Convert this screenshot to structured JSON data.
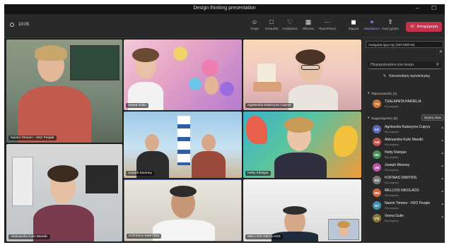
{
  "window": {
    "title": "Design thinking presentation",
    "minimize": "–",
    "close": "☐"
  },
  "meeting": {
    "elapsed": "10:05"
  },
  "toolbar": {
    "buttons": [
      {
        "id": "people",
        "label": "Άτομα",
        "icon": "people-icon"
      },
      {
        "id": "chat",
        "label": "Συνομιλία",
        "icon": "chat-icon"
      },
      {
        "id": "react",
        "label": "Αντιδράσεις",
        "icon": "react-icon"
      },
      {
        "id": "rooms",
        "label": "Αίθουσες",
        "icon": "rooms-icon"
      },
      {
        "id": "more",
        "label": "Περισσότερα",
        "icon": "more-icon"
      },
      {
        "id": "camera",
        "label": "Κάμερα",
        "icon": "camera-icon"
      },
      {
        "id": "mic",
        "label": "Μικρόφωνο",
        "icon": "mic-icon"
      },
      {
        "id": "share",
        "label": "Κοινή χρήση",
        "icon": "share-icon"
      }
    ],
    "leave_label": "Αποχώρηση"
  },
  "tiles": [
    {
      "name": "Naomi Timmer - H2O People"
    },
    {
      "name": "Vesna Gulin"
    },
    {
      "name": "Agnieszka Katarzyna Cuprys"
    },
    {
      "name": "Joseph Mooney"
    },
    {
      "name": "Hetty Kleinjan"
    },
    {
      "name": "Aleksandra Kulic Mandic"
    },
    {
      "name": "KOFINAS DIMITRIS"
    },
    {
      "name": "MELLIOS NIKOLAOS"
    }
  ],
  "panel": {
    "tooltip": "Ανοίγματα ήχου της (Ctrl+Shift+M)",
    "search_placeholder": "Πληκτρολογήστε ένα όνομα",
    "share_invite": "Κοινοποίηση πρόσκλησης",
    "presenters_header": "Παρουσιαστές (1)",
    "attendees_header": "Συμμετέχοντες (8)",
    "mute_all": "Σίγαση όλων",
    "role": "Εξωτερικός",
    "presenters": [
      {
        "initials": "TH",
        "name": "TSALAPATA HARIKLIA",
        "color": "#c8763c"
      }
    ],
    "attendees": [
      {
        "initials": "AC",
        "name": "Agnieszka Katarzyna Cuprys",
        "color": "#5b6bbf"
      },
      {
        "initials": "AM",
        "name": "Aleksandra Kulic Mandić",
        "color": "#c0504d"
      },
      {
        "initials": "HK",
        "name": "Hetty Kleinjan",
        "color": "#4a8f5c"
      },
      {
        "initials": "JM",
        "name": "Joseph Mooney",
        "color": "#b85aa8"
      },
      {
        "initials": "KD",
        "name": "KOFINAS DIMITRIS",
        "color": "#7a7a7a"
      },
      {
        "initials": "MN",
        "name": "MELLIOS NIKOLAOS",
        "color": "#d0643a"
      },
      {
        "initials": "NT",
        "name": "Naomi Timmer - H2O People",
        "color": "#3f8fb5"
      },
      {
        "initials": "VG",
        "name": "Vesna Gulin",
        "color": "#8a7a3c"
      }
    ]
  }
}
